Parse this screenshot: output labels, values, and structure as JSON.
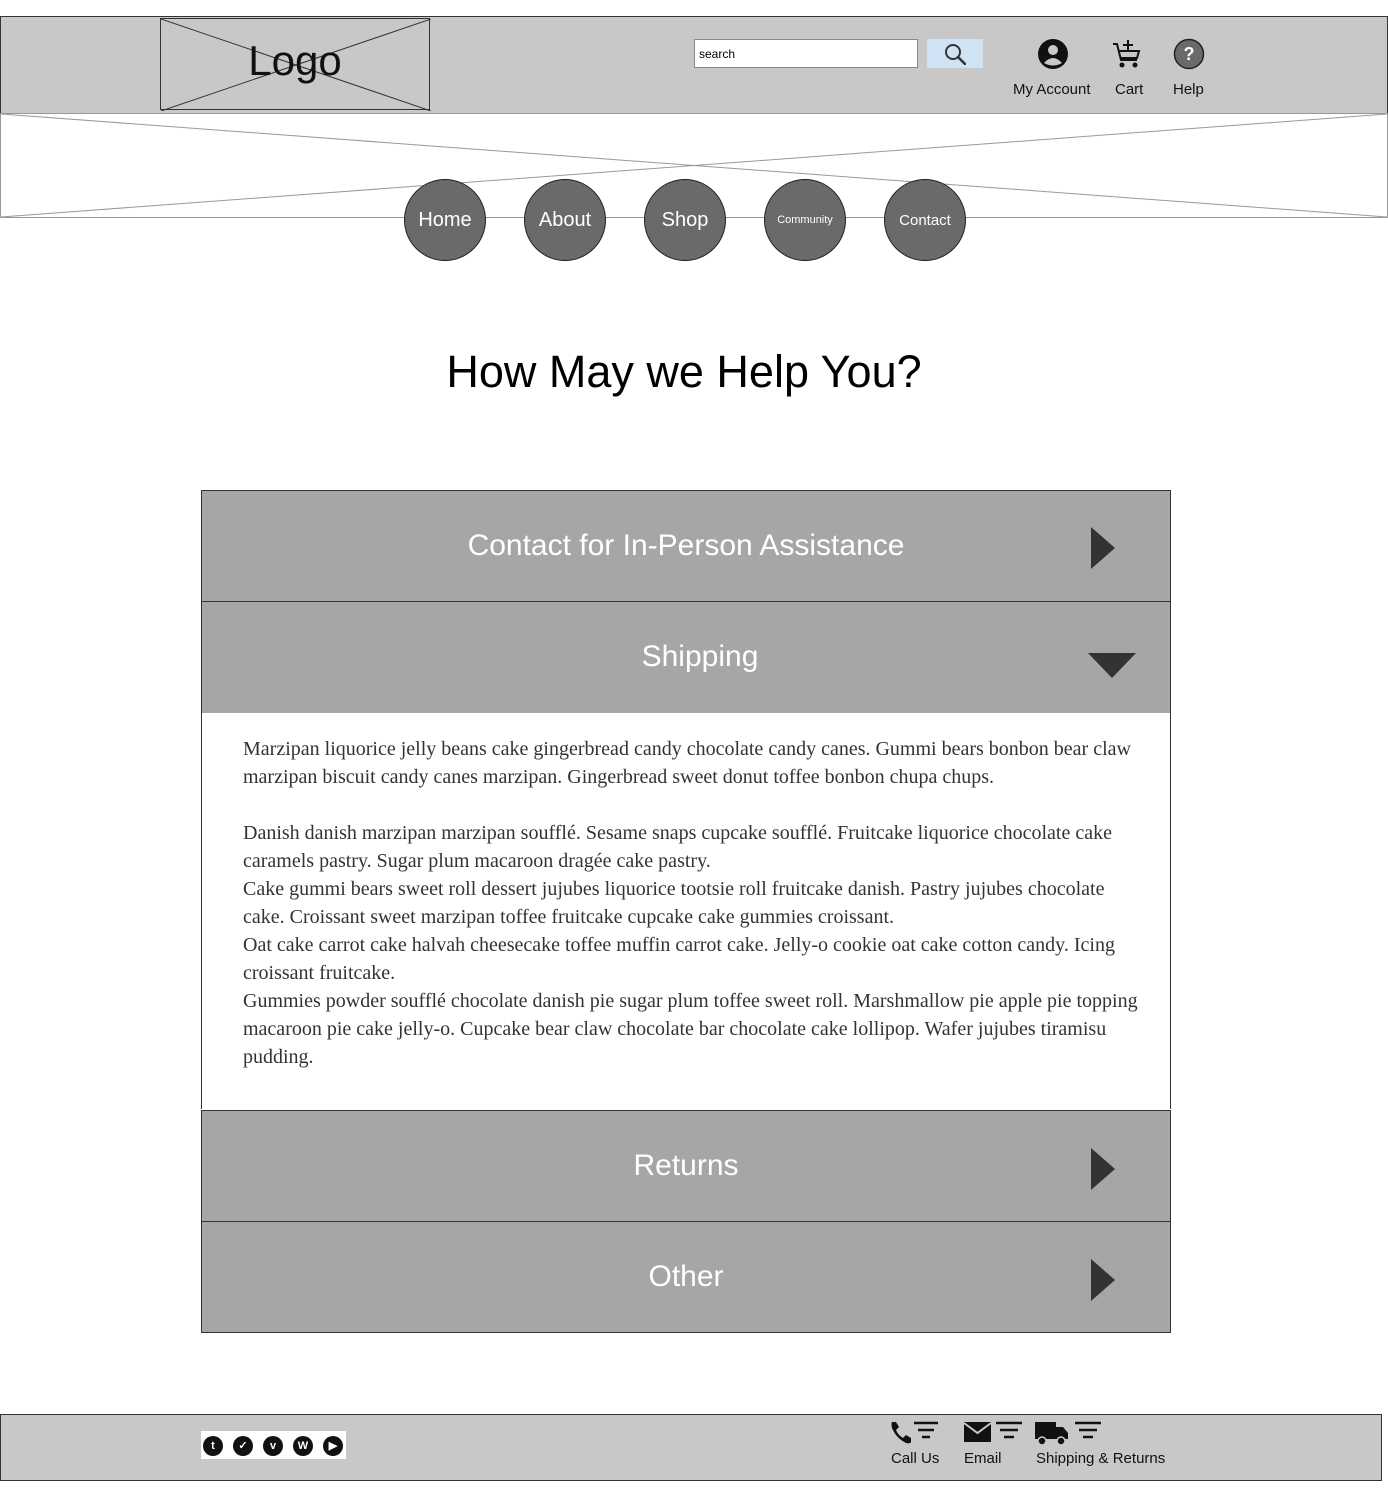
{
  "header": {
    "logo_text": "Logo",
    "search": {
      "value": "search"
    },
    "account_label": "My Account",
    "cart_label": "Cart",
    "help_label": "Help"
  },
  "nav": {
    "home": "Home",
    "about": "About",
    "shop": "Shop",
    "community": "Community",
    "contact": "Contact"
  },
  "page": {
    "title": "How May we Help You?"
  },
  "accordion": {
    "contact": "Contact for In-Person Assistance",
    "shipping": "Shipping",
    "returns": "Returns",
    "other": "Other",
    "shipping_paragraphs": [
      "Marzipan liquorice jelly beans cake gingerbread candy chocolate candy canes. Gummi bears bonbon bear claw marzipan biscuit candy canes marzipan. Gingerbread sweet donut toffee bonbon chupa chups.",
      "Danish danish marzipan marzipan soufflé. Sesame snaps cupcake soufflé. Fruitcake liquorice chocolate cake caramels pastry. Sugar plum macaroon dragée cake pastry.",
      "Cake gummi bears sweet roll dessert jujubes liquorice tootsie roll fruitcake danish. Pastry jujubes chocolate cake. Croissant sweet marzipan toffee fruitcake cupcake cake gummies croissant.",
      "Oat cake carrot cake halvah cheesecake toffee muffin carrot cake. Jelly-o cookie oat cake cotton candy. Icing croissant fruitcake.",
      "Gummies powder soufflé chocolate danish pie sugar plum toffee sweet roll. Marshmallow pie apple pie topping macaroon pie cake jelly-o. Cupcake bear claw chocolate bar chocolate cake lollipop. Wafer jujubes tiramisu pudding."
    ]
  },
  "footer": {
    "social": [
      "t",
      "twitter",
      "v",
      "wordpress",
      "youtube"
    ],
    "call_label": "Call Us",
    "email_label": "Email",
    "shipping_label": "Shipping & Returns"
  }
}
